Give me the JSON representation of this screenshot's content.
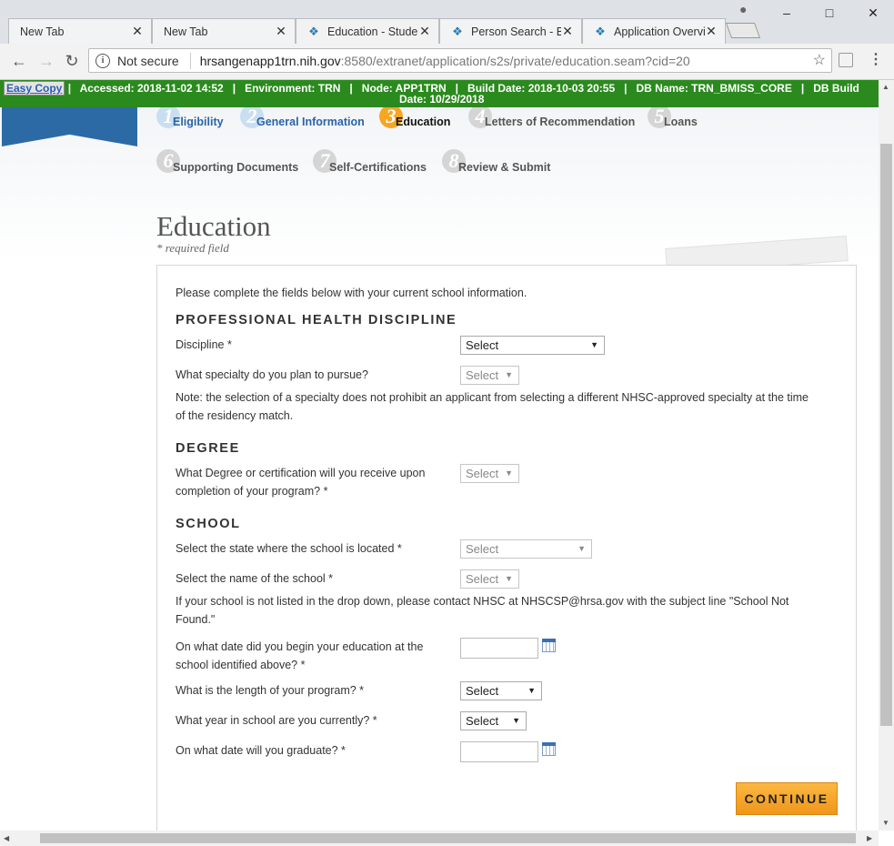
{
  "browser": {
    "tabs": [
      {
        "title": "New Tab",
        "active": false
      },
      {
        "title": "New Tab",
        "active": false
      },
      {
        "title": "Education - Studen",
        "active": true
      },
      {
        "title": "Person Search - BM",
        "active": false
      },
      {
        "title": "Application Overvi",
        "active": false
      }
    ],
    "security_label": "Not secure",
    "url_host": "hrsangenapp1trn.nih.gov",
    "url_rest": ":8580/extranet/application/s2s/private/education.seam?cid=20"
  },
  "envbar": {
    "easy_copy": "Easy Copy",
    "line1": "|   Accessed: 2018-11-02 14:52   |   Environment: TRN   |   Node: APP1TRN   |   Build Date: 2018-10-03 20:55   |   DB Name: TRN_BMISS_CORE   |   DB Build",
    "line2": "Date: 10/29/2018"
  },
  "steps": [
    {
      "num": "1",
      "label": "Eligibility",
      "state": "done"
    },
    {
      "num": "2",
      "label": "General Information",
      "state": "done"
    },
    {
      "num": "3",
      "label": "Education",
      "state": "current"
    },
    {
      "num": "4",
      "label": "Letters of Recommendation",
      "state": "future"
    },
    {
      "num": "5",
      "label": "Loans",
      "state": "future"
    },
    {
      "num": "6",
      "label": "Supporting Documents",
      "state": "future"
    },
    {
      "num": "7",
      "label": "Self-Certifications",
      "state": "future"
    },
    {
      "num": "8",
      "label": "Review & Submit",
      "state": "future"
    }
  ],
  "page": {
    "title": "Education",
    "required_note": "* required field",
    "intro": "Please complete the fields below with your current school information."
  },
  "sections": {
    "discipline_heading": "PROFESSIONAL HEALTH DISCIPLINE",
    "degree_heading": "DEGREE",
    "school_heading": "SCHOOL"
  },
  "fields": {
    "discipline_label": "Discipline *",
    "discipline_value": "Select",
    "specialty_label": "What specialty do you plan to pursue?",
    "specialty_value": "Select",
    "specialty_note_1": "Note: the selection of a specialty does not prohibit an applicant from selecting a different NHSC-approved specialty at the time",
    "specialty_note_2": "of the residency match.",
    "degree_label_1": "What Degree or certification will you receive upon",
    "degree_label_2": "completion of your program? *",
    "degree_value": "Select",
    "state_label": "Select the state where the school is located *",
    "state_value": "Select",
    "school_label": "Select the name of the school *",
    "school_value": "Select",
    "school_note_1": "If your school is not listed in the drop down, please contact NHSC at NHSCSP@hrsa.gov with the subject line \"School Not",
    "school_note_2": "Found.\"",
    "begin_label_1": "On what date did you begin your education at the",
    "begin_label_2": "school identified above? *",
    "length_label": "What is the length of your program? *",
    "length_value": "Select",
    "year_label": "What year in school are you currently? *",
    "year_value": "Select",
    "grad_label": "On what date will you graduate? *"
  },
  "buttons": {
    "continue": "CONTINUE"
  }
}
